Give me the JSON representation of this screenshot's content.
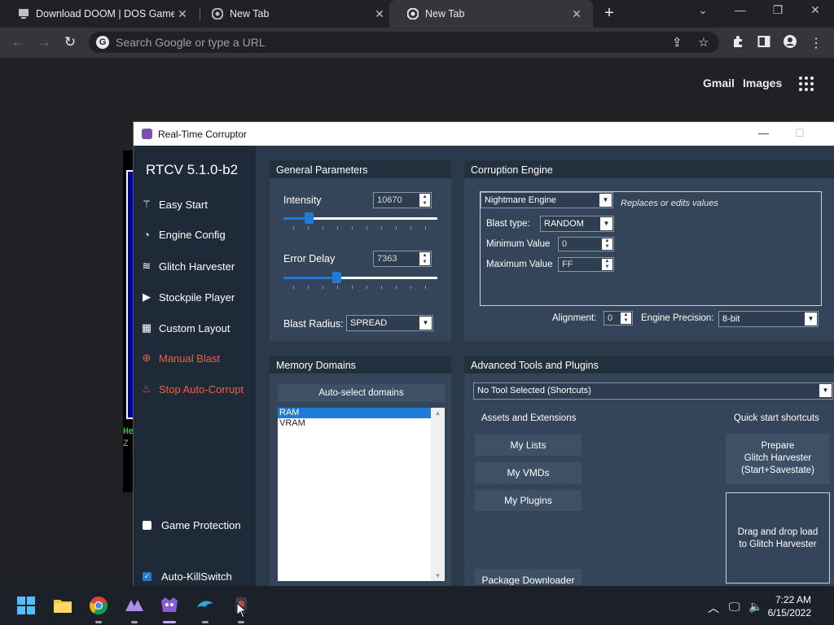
{
  "browser": {
    "tabs": [
      {
        "title": "Download DOOM | DOS Games"
      },
      {
        "title": "New Tab"
      },
      {
        "title": "New Tab"
      }
    ],
    "omnibox_placeholder": "Search Google or type a URL",
    "ntp_links": {
      "gmail": "Gmail",
      "images": "Images"
    }
  },
  "rtc": {
    "window_title": "Real-Time Corruptor",
    "version": "RTCV 5.1.0-b2",
    "sidebar": {
      "items": [
        {
          "label": "Easy Start",
          "icon": "wand-icon"
        },
        {
          "label": "Engine Config",
          "icon": "gauge-icon"
        },
        {
          "label": "Glitch Harvester",
          "icon": "layers-icon"
        },
        {
          "label": "Stockpile Player",
          "icon": "play-icon"
        },
        {
          "label": "Custom Layout",
          "icon": "grid-icon"
        },
        {
          "label": "Manual Blast",
          "icon": "crosshair-icon"
        },
        {
          "label": "Stop Auto-Corrupt",
          "icon": "flame-icon"
        }
      ],
      "game_protection": {
        "label": "Game Protection",
        "checked": false
      },
      "auto_killswitch": {
        "label": "Auto-KillSwitch",
        "checked": true
      }
    },
    "general_parameters": {
      "title": "General Parameters",
      "intensity_label": "Intensity",
      "intensity_value": "10670",
      "error_delay_label": "Error Delay",
      "error_delay_value": "7363",
      "blast_radius_label": "Blast Radius:",
      "blast_radius_value": "SPREAD"
    },
    "corruption_engine": {
      "title": "Corruption Engine",
      "engine": "Nightmare Engine",
      "engine_desc": "Replaces or edits values",
      "blast_type_label": "Blast type:",
      "blast_type_value": "RANDOM",
      "min_label": "Minimum Value",
      "min_value": "0",
      "max_label": "Maximum Value",
      "max_value": "FF",
      "alignment_label": "Alignment:",
      "alignment_value": "0",
      "precision_label": "Engine Precision:",
      "precision_value": "8-bit"
    },
    "memory_domains": {
      "title": "Memory Domains",
      "auto_select": "Auto-select domains",
      "domains": [
        "RAM",
        "VRAM"
      ]
    },
    "advanced_tools": {
      "title": "Advanced Tools and Plugins",
      "tool_select": "No Tool Selected (Shortcuts)",
      "assets_title": "Assets and Extensions",
      "my_lists": "My Lists",
      "my_vmds": "My VMDs",
      "my_plugins": "My Plugins",
      "package_downloader": "Package Downloader",
      "quick_start_title": "Quick start shortcuts",
      "prepare_glitch_harvester": "Prepare\nGlitch Harvester\n(Start+Savestate)",
      "drag_drop": "Drag and drop load\nto Glitch Harvester"
    }
  },
  "taskbar": {
    "time": "7:22 AM",
    "date": "6/15/2022"
  },
  "colors": {
    "chrome_bg": "#202124",
    "rtc_panel": "#34455a",
    "rtc_sidebar": "#1e2a37",
    "accent": "#1e7bd6",
    "red": "#f0603a"
  }
}
